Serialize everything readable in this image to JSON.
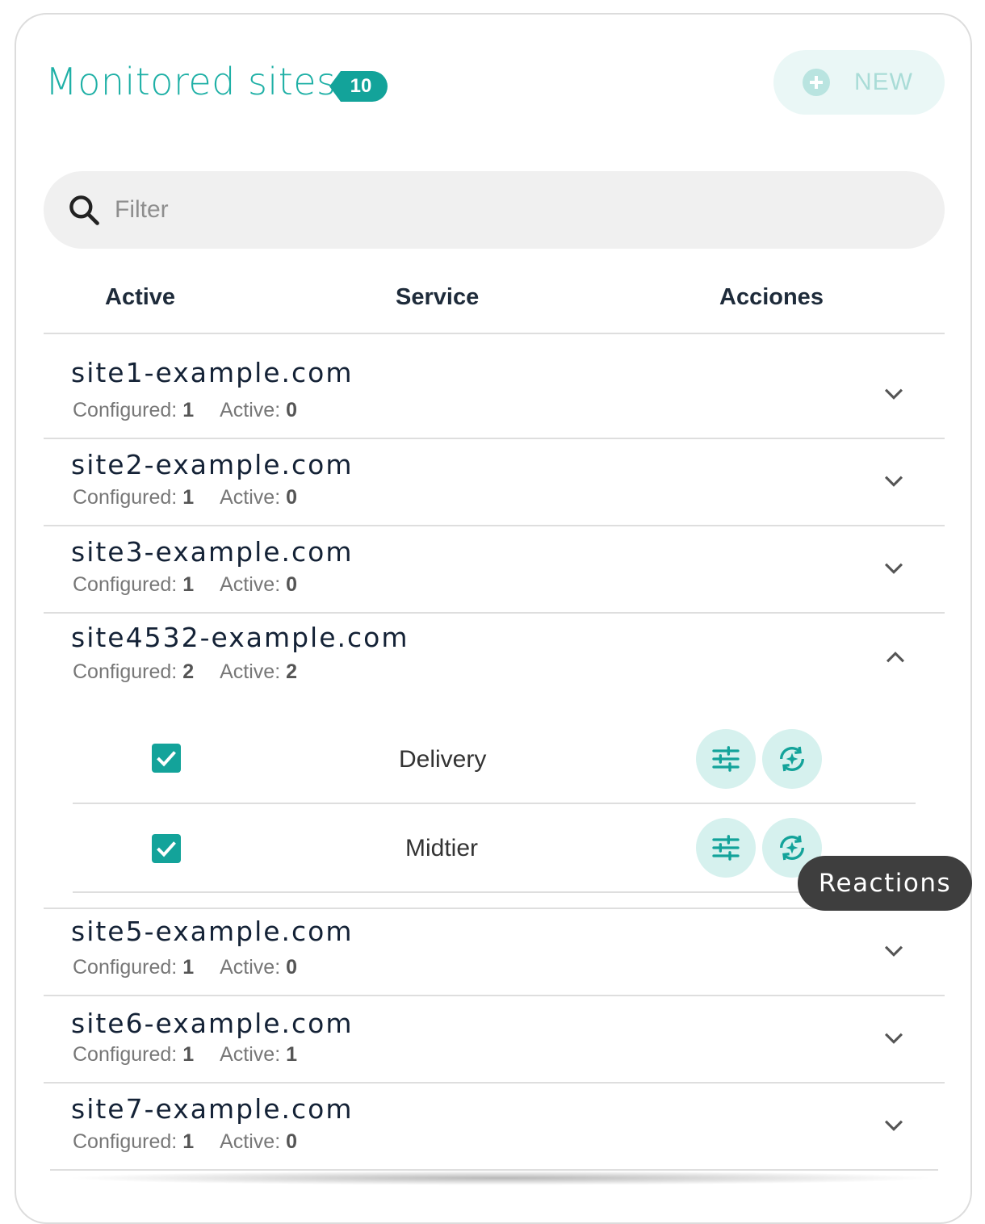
{
  "header": {
    "title": "Monitored sites",
    "count": "10",
    "new_label": "NEW"
  },
  "search": {
    "placeholder": "Filter"
  },
  "columns": {
    "active": "Active",
    "service": "Service",
    "actions": "Acciones"
  },
  "stat_labels": {
    "configured": "Configured:",
    "active": "Active:"
  },
  "sites": [
    {
      "name": "site1-example.com",
      "configured": "1",
      "active": "0",
      "expanded": false
    },
    {
      "name": "site2-example.com",
      "configured": "1",
      "active": "0",
      "expanded": false
    },
    {
      "name": "site3-example.com",
      "configured": "1",
      "active": "0",
      "expanded": false
    },
    {
      "name": "site4532-example.com",
      "configured": "2",
      "active": "2",
      "expanded": true,
      "services": [
        {
          "name": "Delivery",
          "checked": true
        },
        {
          "name": "Midtier",
          "checked": true
        }
      ]
    },
    {
      "name": "site5-example.com",
      "configured": "1",
      "active": "0",
      "expanded": false
    },
    {
      "name": "site6-example.com",
      "configured": "1",
      "active": "1",
      "expanded": false
    },
    {
      "name": "site7-example.com",
      "configured": "1",
      "active": "0",
      "expanded": false
    }
  ],
  "tooltip": "Reactions",
  "colors": {
    "accent": "#13a39a",
    "accent_light": "#d6f1ee",
    "title": "#1fb0a6"
  }
}
